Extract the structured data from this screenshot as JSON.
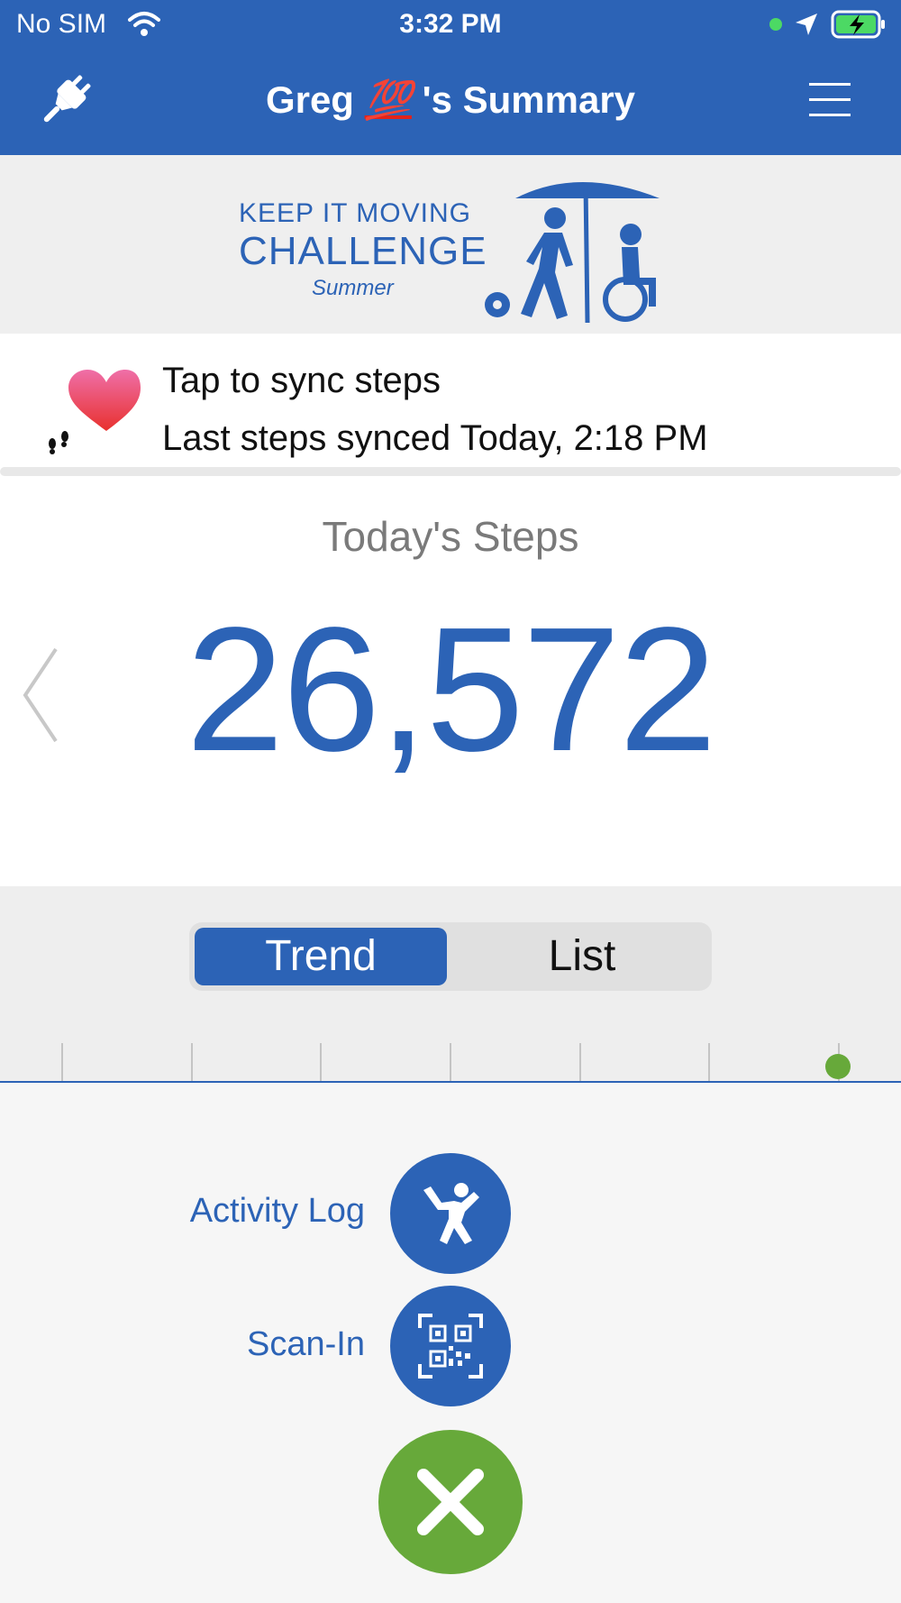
{
  "status_bar": {
    "carrier": "No SIM",
    "time": "3:32 PM"
  },
  "nav": {
    "title_prefix": "Greg",
    "title_emoji": "💯",
    "title_suffix": "'s Summary"
  },
  "banner": {
    "line1": "KEEP IT MOVING",
    "line2": "CHALLENGE",
    "line3": "Summer"
  },
  "sync": {
    "action_text": "Tap to sync steps",
    "last_synced": "Last steps synced Today, 2:18 PM"
  },
  "steps": {
    "label": "Today's Steps",
    "count": "26,572"
  },
  "view_toggle": {
    "options": [
      "Trend",
      "List"
    ],
    "selected": "Trend"
  },
  "actions": {
    "activity_log_label": "Activity Log",
    "scan_in_label": "Scan-In"
  },
  "colors": {
    "primary": "#2c63b6",
    "accent_green": "#67a93a",
    "heart": "#e8424f"
  },
  "icons": {
    "status": [
      "wifi-icon",
      "location-arrow-icon",
      "battery-charging-icon"
    ],
    "nav": [
      "plug-icon",
      "hamburger-menu-icon"
    ],
    "sync": "heart-footsteps-icon",
    "actions": [
      "exercise-person-icon",
      "qr-code-icon",
      "close-icon"
    ]
  }
}
